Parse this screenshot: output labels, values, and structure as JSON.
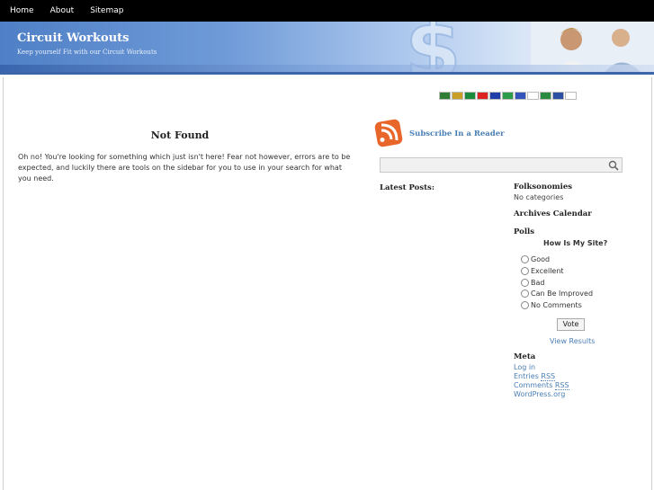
{
  "nav": {
    "items": [
      "Home",
      "About",
      "Sitemap"
    ]
  },
  "site": {
    "title": "Circuit Workouts",
    "tagline": "Keep yourself Fit with our Circuit Workouts"
  },
  "flags": [
    {
      "name": "arabic-flag-icon",
      "color": "#2e7d32"
    },
    {
      "name": "german-flag-icon",
      "color": "#c8a028"
    },
    {
      "name": "portuguese-flag-icon",
      "color": "#1b8a3a"
    },
    {
      "name": "chinese-flag-icon",
      "color": "#d22"
    },
    {
      "name": "taiwan-flag-icon",
      "color": "#1f3fa8"
    },
    {
      "name": "italian-flag-icon",
      "color": "#2d9c4a"
    },
    {
      "name": "russian-flag-icon",
      "color": "#3355bb"
    },
    {
      "name": "japanese-flag-icon",
      "color": "#ffffff"
    },
    {
      "name": "mexican-flag-icon",
      "color": "#2a8a3f"
    },
    {
      "name": "french-flag-icon",
      "color": "#2c4fa3"
    },
    {
      "name": "korean-flag-icon",
      "color": "#ffffff"
    }
  ],
  "main": {
    "title": "Not Found",
    "text": "Oh no! You're looking for something which just isn't here! Fear not however, errors are to be expected, and luckily there are tools on the sidebar for you to use in your search for what you need."
  },
  "sidebar": {
    "subscribe": "Subscribe In a Reader",
    "latest_posts": "Latest Posts:",
    "folksonomies": {
      "heading": "Folksonomies",
      "text": "No categories"
    },
    "archives": "Archives Calendar",
    "polls": {
      "heading": "Polls",
      "question": "How Is My Site?",
      "options": [
        "Good",
        "Excellent",
        "Bad",
        "Can Be Improved",
        "No Comments"
      ],
      "vote": "Vote",
      "results": "View Results"
    },
    "meta": {
      "heading": "Meta",
      "login": "Log in",
      "entries_prefix": "Entries ",
      "entries_abbr": "RSS",
      "comments_prefix": "Comments ",
      "comments_abbr": "RSS",
      "wordpress": "WordPress.org"
    }
  },
  "colors": {
    "nav_bg": "#000000",
    "link": "#4a7fb5",
    "banner": "#4f7fc6",
    "rss": "#e8662a"
  }
}
